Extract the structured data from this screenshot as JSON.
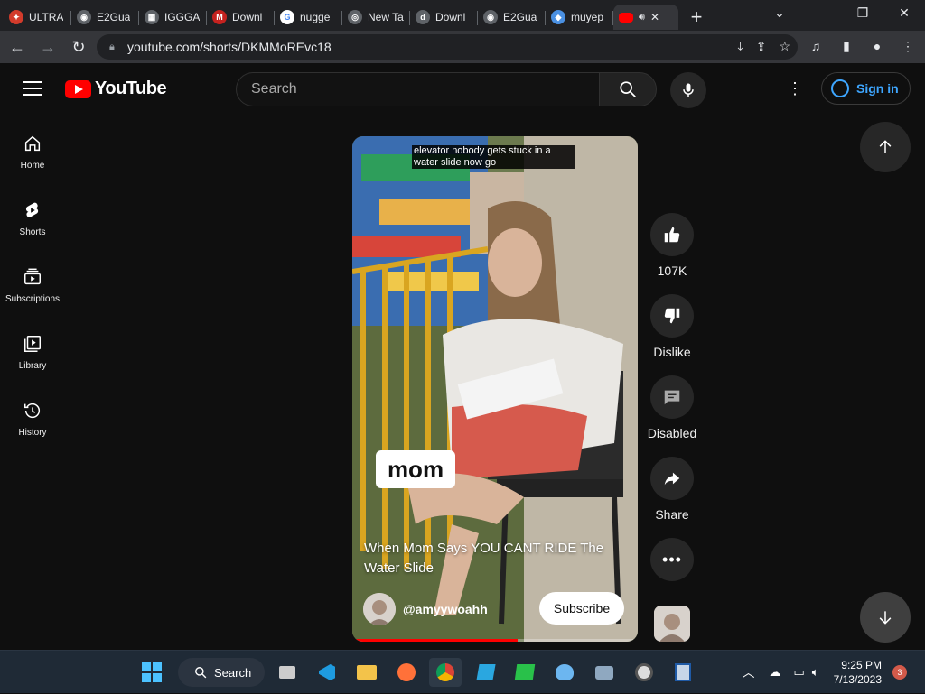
{
  "browser": {
    "tabs": [
      {
        "label": "ULTRA",
        "color": "#d23b2b",
        "glyph": "✦"
      },
      {
        "label": "E2Gua",
        "color": "#5f6368",
        "glyph": "◉"
      },
      {
        "label": "IGGGA",
        "color": "#5f6368",
        "glyph": "▦"
      },
      {
        "label": "Downl",
        "color": "#c5221f",
        "glyph": "M"
      },
      {
        "label": "nugge",
        "color": "#ffffff",
        "glyph": "G"
      },
      {
        "label": "New Ta",
        "color": "#5f6368",
        "glyph": "◎"
      },
      {
        "label": "Downl",
        "color": "#5f6368",
        "glyph": "d"
      },
      {
        "label": "E2Gua",
        "color": "#5f6368",
        "glyph": "◉"
      },
      {
        "label": "muyep",
        "color": "#4a90e2",
        "glyph": "◆"
      }
    ],
    "active_tab_icon": "youtube-icon",
    "url": "youtube.com/shorts/DKMMoREvc18"
  },
  "youtube": {
    "logo_text": "YouTube",
    "search_placeholder": "Search",
    "sign_in": "Sign in",
    "sidebar": [
      {
        "label": "Home",
        "icon": "home-icon"
      },
      {
        "label": "Shorts",
        "icon": "shorts-icon"
      },
      {
        "label": "Subscriptions",
        "icon": "subscriptions-icon"
      },
      {
        "label": "Library",
        "icon": "library-icon"
      },
      {
        "label": "History",
        "icon": "history-icon"
      }
    ],
    "short": {
      "overlay_caption": "elevator nobody gets stuck in a water slide now go",
      "sticker": "mom",
      "title": "When Mom Says YOU CANT RIDE The Water Slide",
      "channel": "@amyywoahh",
      "subscribe": "Subscribe",
      "progress_fraction": 0.58
    },
    "actions": {
      "likes": "107K",
      "dislike": "Dislike",
      "comments": "Disabled",
      "share": "Share"
    }
  },
  "taskbar": {
    "search": "Search",
    "time": "9:25 PM",
    "date": "7/13/2023",
    "notifications": "3"
  },
  "colors": {
    "background": "#0f0f0f",
    "brand_red": "#ff0000",
    "link_blue": "#3ea6ff"
  }
}
